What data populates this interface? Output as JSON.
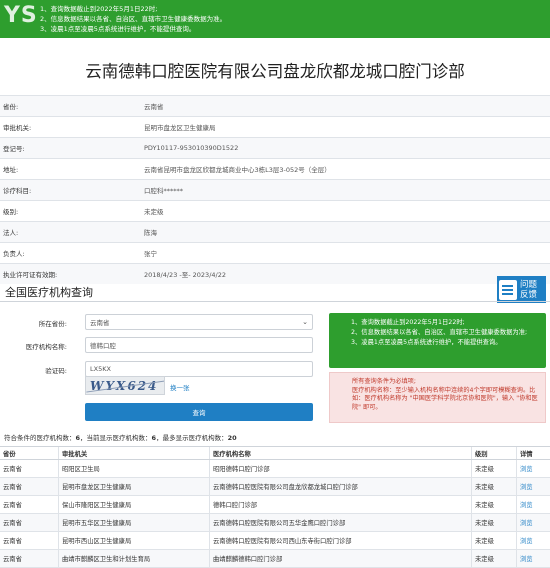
{
  "notice": {
    "logo": "YS",
    "logo_ghost": "",
    "lines": [
      "1、查询数据截止到2022年5月1日22时;",
      "2、信息数据结果以各省、自治区、直辖市卫生健康委数据为准。",
      "3、凌晨1点至凌晨5点系统进行维护，不能提供查询。"
    ]
  },
  "org_title": "云南德韩口腔医院有限公司盘龙欣都龙城口腔门诊部",
  "detail": [
    {
      "key": "省份:",
      "value": "云南省"
    },
    {
      "key": "审批机关:",
      "value": "昆明市盘龙区卫生健康局"
    },
    {
      "key": "登记号:",
      "value": "PDY10117-953010390D1522"
    },
    {
      "key": "地址:",
      "value": "云南省昆明市盘龙区欣都龙城商业中心3栋L3层3-052号（全层）"
    },
    {
      "key": "诊疗科目:",
      "value": "口腔科******"
    },
    {
      "key": "级别:",
      "value": "未定级"
    },
    {
      "key": "法人:",
      "value": "陈海"
    },
    {
      "key": "负责人:",
      "value": "张宁"
    },
    {
      "key": "执业许可证有效期:",
      "value": "2018/4/23 -至- 2023/4/22"
    }
  ],
  "query_section": {
    "title": "全国医疗机构查询",
    "feedback": "问题反馈",
    "province_label": "所在省份:",
    "province_value": "云南省",
    "org_name_label": "医疗机构名称:",
    "org_name_value": "德韩口腔",
    "captcha_label": "验证码:",
    "captcha_value": "LX5KX",
    "captcha_image_text": "WYX624",
    "refresh_label": "换一张",
    "query_button": "查询"
  },
  "green_box": [
    "1、查询数据截止到2022年5月1日22时;",
    "2、信息数据结果以各省、自治区、直辖市卫生健康委数据为准;",
    "3、凌晨1点至凌晨5点系统进行维护，不能提供查询。"
  ],
  "pink_box": [
    "所有查询条件为必填项;",
    "医疗机构名称：至少输入机构名称中连续的4个字即可模糊查询。比如：医疗机构名称为 \"中国医学科学院北京协和医院\"，输入 \"协和医院\" 即可。"
  ],
  "summary": {
    "prefix": "符合条件的医疗机构数：",
    "total": "6",
    "mid": "，当前显示医疗机构数：",
    "current": "6",
    "max_text": "，最多显示医疗机构数：",
    "max": "20"
  },
  "result_headers": [
    "省份",
    "审批机关",
    "医疗机构名称",
    "级别",
    "详情"
  ],
  "results": [
    {
      "province": "云南省",
      "authority": "昭阳区卫生局",
      "name": "昭阳德韩口腔门诊部",
      "level": "未定级",
      "detail": "浏览"
    },
    {
      "province": "云南省",
      "authority": "昆明市盘龙区卫生健康局",
      "name": "云南德韩口腔医院有限公司盘龙欣都龙城口腔门诊部",
      "level": "未定级",
      "detail": "浏览"
    },
    {
      "province": "云南省",
      "authority": "保山市隆阳区卫生健康局",
      "name": "德韩口腔门诊部",
      "level": "未定级",
      "detail": "浏览"
    },
    {
      "province": "云南省",
      "authority": "昆明市五华区卫生健康局",
      "name": "云南德韩口腔医院有限公司五华金鹰口腔门诊部",
      "level": "未定级",
      "detail": "浏览"
    },
    {
      "province": "云南省",
      "authority": "昆明市西山区卫生健康局",
      "name": "云南德韩口腔医院有限公司西山东寺街口腔门诊部",
      "level": "未定级",
      "detail": "浏览"
    },
    {
      "province": "云南省",
      "authority": "曲靖市麒麟区卫生和计划生育局",
      "name": "曲靖麒麟德韩口腔门诊部",
      "level": "未定级",
      "detail": "浏览"
    }
  ]
}
